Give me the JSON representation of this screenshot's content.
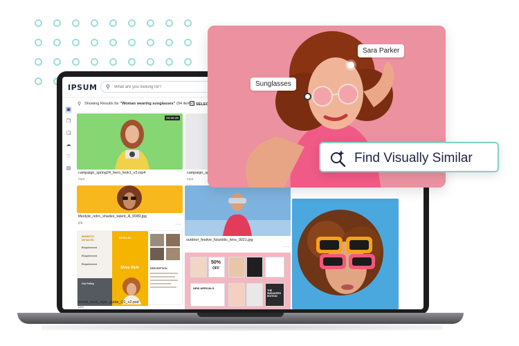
{
  "app": {
    "logo": "IPSUM",
    "search_placeholder": "What are you looking for?"
  },
  "results": {
    "prefix": "Showing Results for ",
    "query": "\"Woman wearing sunglasses\"",
    "count": " (94 items)",
    "select_label": "SELEC"
  },
  "nav_icons": [
    "image-icon",
    "copy-icon",
    "collection-icon",
    "cloud-icon",
    "heart-icon",
    "document-icon"
  ],
  "cards": {
    "c1": {
      "name": "campaign_spring24_hero_look1_v3.mp4",
      "type": "mp4",
      "duration": "00:05:25"
    },
    "c2": {
      "name": "campaign_sp",
      "type": "mp4"
    },
    "c3": {
      "name": "lifestyle_retro_shades_talent_A_0089.jpg",
      "type": "jpg"
    },
    "c4": {
      "name": "outdoor_festive_futuristic_lens_0021.jpg",
      "type": "jpg"
    },
    "c5": {
      "name": "brand_deck_style_guide_Q1_v2.psd",
      "type": "psd"
    },
    "c6": {
      "type": "jpg"
    }
  },
  "doc": {
    "heading1": "BENEFITS",
    "heading2": "DETAILED",
    "req": "Requirement",
    "our_policy": "Our Policy",
    "desc": "DESCRIPTION",
    "script": "Shiny Style"
  },
  "collage": {
    "discount": "50%",
    "off": "OFF",
    "new_arrivals": "NEW ARRIVALS",
    "super_edition": "THE SNEAKERS EDITION"
  },
  "hero": {
    "tag_person": "Sara Parker",
    "tag_object": "Sunglasses"
  },
  "cta": {
    "label": "Find Visually Similar"
  },
  "colors": {
    "accent": "#7ed1c7",
    "brand": "#1f2a44",
    "hero_bg": "#e98d9d",
    "doc_yellow": "#f4b400"
  }
}
